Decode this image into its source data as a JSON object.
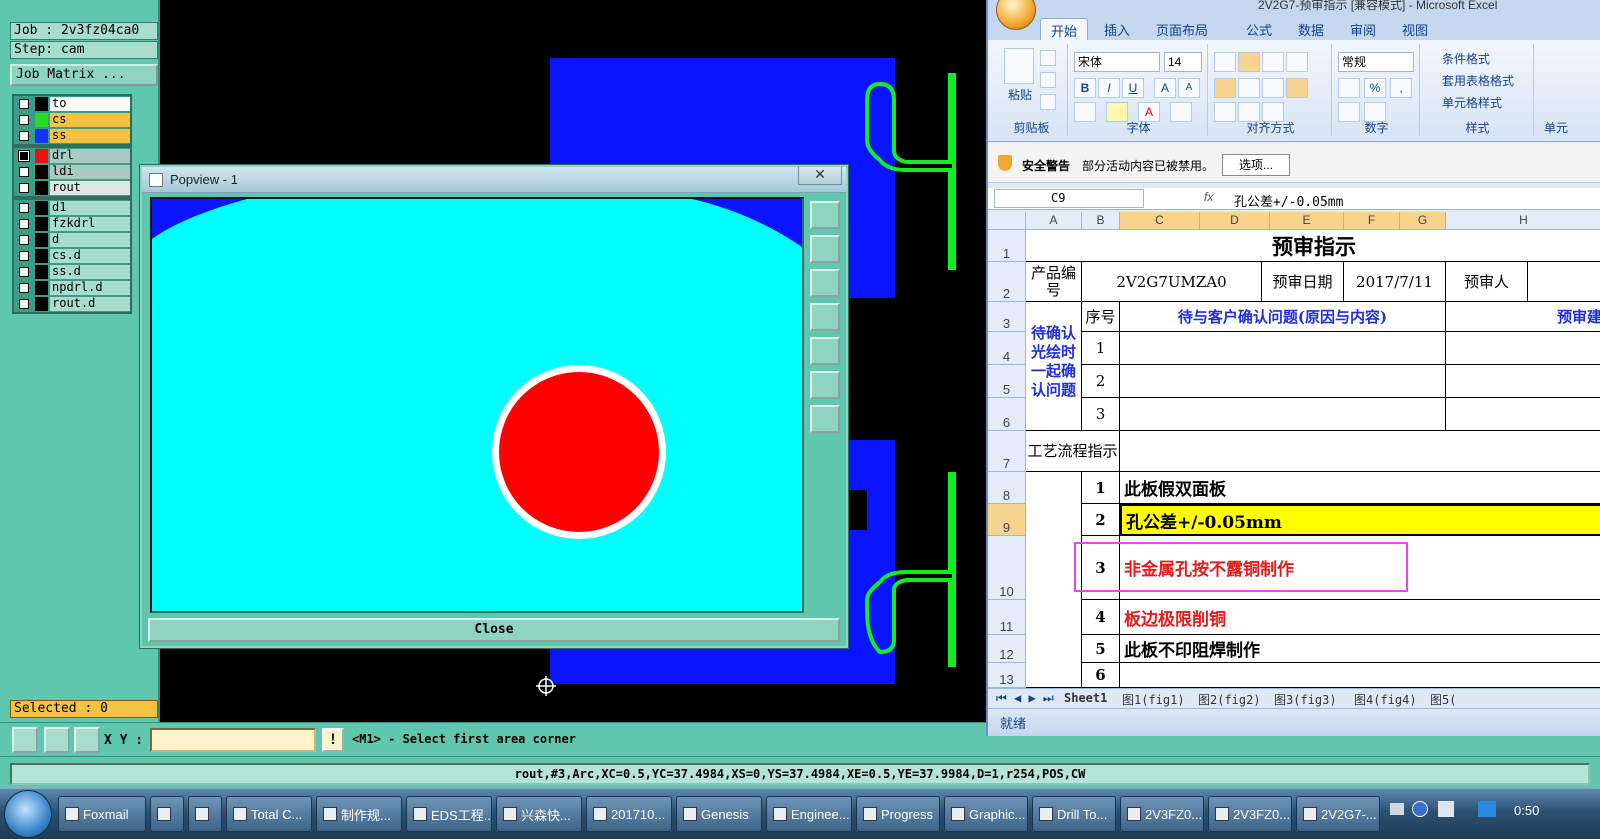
{
  "genesis": {
    "job": "Job : 2v3fz04ca0",
    "step": "Step: cam",
    "job_matrix": "Job Matrix ...",
    "layer_groups": [
      [
        {
          "name": "to",
          "color": "#000000",
          "bg": "#ffffff"
        },
        {
          "name": "cs",
          "color": "#22dd22",
          "bg": "#f5c242"
        },
        {
          "name": "ss",
          "color": "#1133ff",
          "bg": "#f5c242"
        }
      ],
      [
        {
          "name": "drl",
          "color": "#ee1111",
          "bg": "#a9c9c1",
          "checked": true
        },
        {
          "name": "ldi",
          "color": "#000000",
          "bg": "#a9c9c1"
        },
        {
          "name": "rout",
          "color": "#000000",
          "bg": "#dfe6e4"
        }
      ],
      [
        {
          "name": "d1",
          "color": "#000000",
          "bg": "#a8dccd"
        },
        {
          "name": "fzkdrl",
          "color": "#000000",
          "bg": "#a8dccd"
        },
        {
          "name": "d",
          "color": "#000000",
          "bg": "#a8dccd"
        },
        {
          "name": "cs.d",
          "color": "#000000",
          "bg": "#a8dccd"
        },
        {
          "name": "ss.d",
          "color": "#000000",
          "bg": "#a8dccd"
        },
        {
          "name": "npdrl.d",
          "color": "#000000",
          "bg": "#a8dccd"
        },
        {
          "name": "rout.d",
          "color": "#000000",
          "bg": "#a8dccd"
        }
      ]
    ],
    "selected": "Selected : 0",
    "xy_label": "X Y :",
    "xy_value": "",
    "excl": "!",
    "prompt": "<M1> - Select first area corner",
    "status": "rout,#3,Arc,XC=0.5,YC=37.4984,XS=0,YS=37.4984,XE=0.5,YE=37.9984,D=1,r254,POS,CW",
    "popview": {
      "title": "Popview - 1",
      "close_x": "✕",
      "close_button": "Close"
    }
  },
  "excel": {
    "title": "2V2G7-预审指示 [兼容模式] - Microsoft Excel",
    "tabs": [
      "开始",
      "插入",
      "页面布局",
      "公式",
      "数据",
      "审阅",
      "视图"
    ],
    "ribbon": {
      "paste": "粘贴",
      "font_name": "宋体",
      "font_size": "14",
      "number_format": "常规",
      "cond_format": "条件格式",
      "table_format": "套用表格格式",
      "cell_style": "单元格样式",
      "groups": [
        "剪贴板",
        "字体",
        "对齐方式",
        "数字",
        "样式",
        "单元"
      ]
    },
    "security": {
      "label": "安全警告",
      "message": "部分活动内容已被禁用。",
      "options": "选项..."
    },
    "name_box": "C9",
    "fx": "fx",
    "formula": "孔公差+/-0.05mm",
    "columns": [
      "A",
      "B",
      "C",
      "D",
      "E",
      "F",
      "G",
      "H"
    ],
    "rows": [
      "1",
      "2",
      "3",
      "4",
      "5",
      "6",
      "7",
      "8",
      "9",
      "10",
      "11",
      "12",
      "13"
    ],
    "cells": {
      "title": "预审指示",
      "product_label": "产品编号",
      "product_value": "2V2G7UMZA0",
      "date_label": "预审日期",
      "date_value": "2017/7/11",
      "reviewer_label": "预审人",
      "seq_label": "序号",
      "issue_header": "待与客户确认问题(原因与内容)",
      "suggest_header": "预审建",
      "pending_label": "待确认光绘时一起确认问题",
      "seq1": "1",
      "seq2": "2",
      "seq3": "3",
      "process_label": "工艺流程指示",
      "items": [
        {
          "no": "1",
          "text": "此板假双面板"
        },
        {
          "no": "2",
          "text": "孔公差+/-0.05mm"
        },
        {
          "no": "3",
          "text": "非金属孔按不露铜制作"
        },
        {
          "no": "4",
          "text": "板边极限削铜"
        },
        {
          "no": "5",
          "text": "此板不印阻焊制作"
        },
        {
          "no": "6",
          "text": ""
        }
      ]
    },
    "sheet_tabs": [
      "Sheet1",
      "图1(fig1)",
      "图2(fig2)",
      "图3(fig3)",
      "图4(fig4)",
      "图5("
    ],
    "ready": "就绪"
  },
  "taskbar": {
    "items": [
      "Foxmail",
      "",
      "",
      "Total C...",
      "制作规...",
      "EDS工程...",
      "兴森快...",
      "201710...",
      "Genesis",
      "Enginee...",
      "Progress",
      "Graphic...",
      "Drill To...",
      "2V3FZ0...",
      "2V3FZ0...",
      "2V2G7-..."
    ],
    "clock": "0:50"
  },
  "colors": {
    "cyan": "#00ffff",
    "blue": "#0a14ff",
    "green": "#11ee22",
    "red": "#ff0000",
    "panel": "#5ec7ae",
    "highlight_yellow": "#ffff00",
    "annotation_magenta": "#ee44ee"
  }
}
